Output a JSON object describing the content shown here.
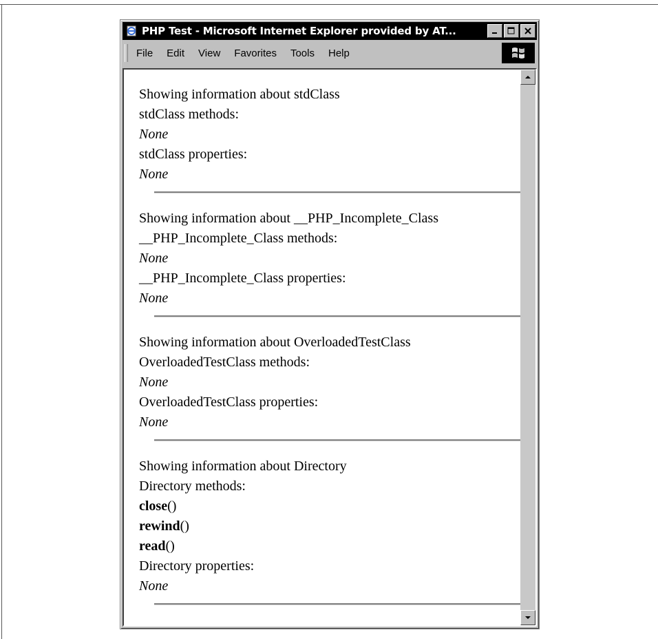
{
  "window": {
    "title": "PHP Test - Microsoft Internet Explorer provided by AT...",
    "controls": {
      "minimize": "_",
      "maximize": "□",
      "close": "X"
    }
  },
  "menu": {
    "items": [
      {
        "label": "File"
      },
      {
        "label": "Edit"
      },
      {
        "label": "View"
      },
      {
        "label": "Favorites"
      },
      {
        "label": "Tools"
      },
      {
        "label": "Help"
      }
    ]
  },
  "sections": [
    {
      "heading": "Showing information about stdClass",
      "methods_label": "stdClass methods:",
      "methods": [],
      "methods_none": "None",
      "properties_label": "stdClass properties:",
      "properties_none": "None"
    },
    {
      "heading": "Showing information about __PHP_Incomplete_Class",
      "methods_label": "__PHP_Incomplete_Class methods:",
      "methods": [],
      "methods_none": "None",
      "properties_label": "__PHP_Incomplete_Class properties:",
      "properties_none": "None"
    },
    {
      "heading": "Showing information about OverloadedTestClass",
      "methods_label": "OverloadedTestClass methods:",
      "methods": [],
      "methods_none": "None",
      "properties_label": "OverloadedTestClass properties:",
      "properties_none": "None"
    },
    {
      "heading": "Showing information about Directory",
      "methods_label": "Directory methods:",
      "methods": [
        {
          "name": "close",
          "parens": "()"
        },
        {
          "name": "rewind",
          "parens": "()"
        },
        {
          "name": "read",
          "parens": "()"
        }
      ],
      "methods_none": "",
      "properties_label": "Directory properties:",
      "properties_none": "None"
    }
  ],
  "icons": {
    "title": "ie-page-icon",
    "throbber": "windows-logo-icon",
    "scroll_up": "scroll-up-arrow-icon",
    "scroll_down": "scroll-down-arrow-icon"
  }
}
